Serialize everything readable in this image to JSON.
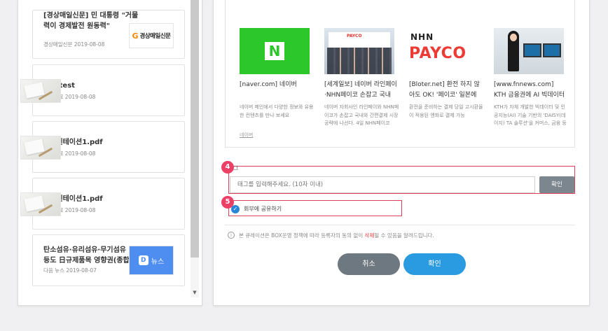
{
  "left_cards": [
    {
      "title_line1": "[경상매일신문] 민 대통령 \"거물",
      "title_line2": "력이 경제발전 원동력\"",
      "meta": "경상매일신문 2019-08-08",
      "thumb_type": "logo",
      "logo_mark": "G",
      "logo_text": "경상매일신문"
    },
    {
      "title_line1": "pdf-test",
      "title_line2": "",
      "meta": "PDF자료 2019-08-08",
      "thumb_type": "paper"
    },
    {
      "title_line1": "프레젠테이션1.pdf",
      "title_line2": "",
      "meta": "PDF자료 2019-08-08",
      "thumb_type": "paper"
    },
    {
      "title_line1": "프레젠테이션1.pdf",
      "title_line2": "",
      "meta": "PDF자료 2019-08-08",
      "thumb_type": "paper"
    },
    {
      "title_line1": "탄소섬유·유리섬유·무기섬유",
      "title_line2": "등도 日규제품목 영향권(종합)",
      "meta": "다음 뉴스 2019-08-07",
      "thumb_type": "news",
      "logo_mark": "D",
      "logo_text": "뉴스"
    }
  ],
  "news": [
    {
      "title": "[naver.com] 네이버",
      "desc": "네이버 메인에서 다양한 정보와 유용한 컨텐츠를 만나 보세요",
      "source": "네이버",
      "image": "naver-logo",
      "image_text": "N"
    },
    {
      "title": "[세계일보] 네이버 라인페이·NHN페이코 손잡고 국내",
      "desc": "네이버 자회사인 라인페이와 NHN페이코가 손잡고 국내와 간편결제 시장 공략에 나선다. 4일 NHN페이코",
      "source": "",
      "image": "segye-photo",
      "image_text": "PAYCO"
    },
    {
      "title": "[Bloter.net] 환전 하지 않아도 OK! '페이코' 일본에서",
      "desc": "환전을 준비하는 결제 당일 고시환율이 적용된 엔화로 결제 가능",
      "source": "",
      "image": "payco-logo",
      "image_text": "PAYCO",
      "image_sub": "NHN"
    },
    {
      "title": "[www.fnnews.com] KTH 금융권에 AI 빅데이터 분석",
      "desc": "KTH가 자체 개발한 빅데이터 및 인공지능(AI) 기술 기반의 'DAISY(데이지) TA 솔루션'을 커머스, 금융 등 다",
      "source": "",
      "image": "fnnews-photo"
    }
  ],
  "tag": {
    "step": "4",
    "label_fragment": "그",
    "placeholder": "태그를 입력해주세요. (10자 이내)",
    "confirm_label": "확인"
  },
  "share": {
    "step": "5",
    "label": "회부에 공유하기",
    "checked": true
  },
  "notice": {
    "before": "본 큐레이션은 BOX운영 정책에 따라 등록자의 동의 없이 ",
    "highlight": "삭제",
    "after": "될 수 있음을 알려드립니다."
  },
  "buttons": {
    "cancel": "취소",
    "ok": "확인"
  },
  "colors": {
    "accent_blue": "#2a9be0",
    "highlight_red": "#e0405a",
    "badge_pink": "#ec4066",
    "naver_green": "#2bc72b"
  }
}
